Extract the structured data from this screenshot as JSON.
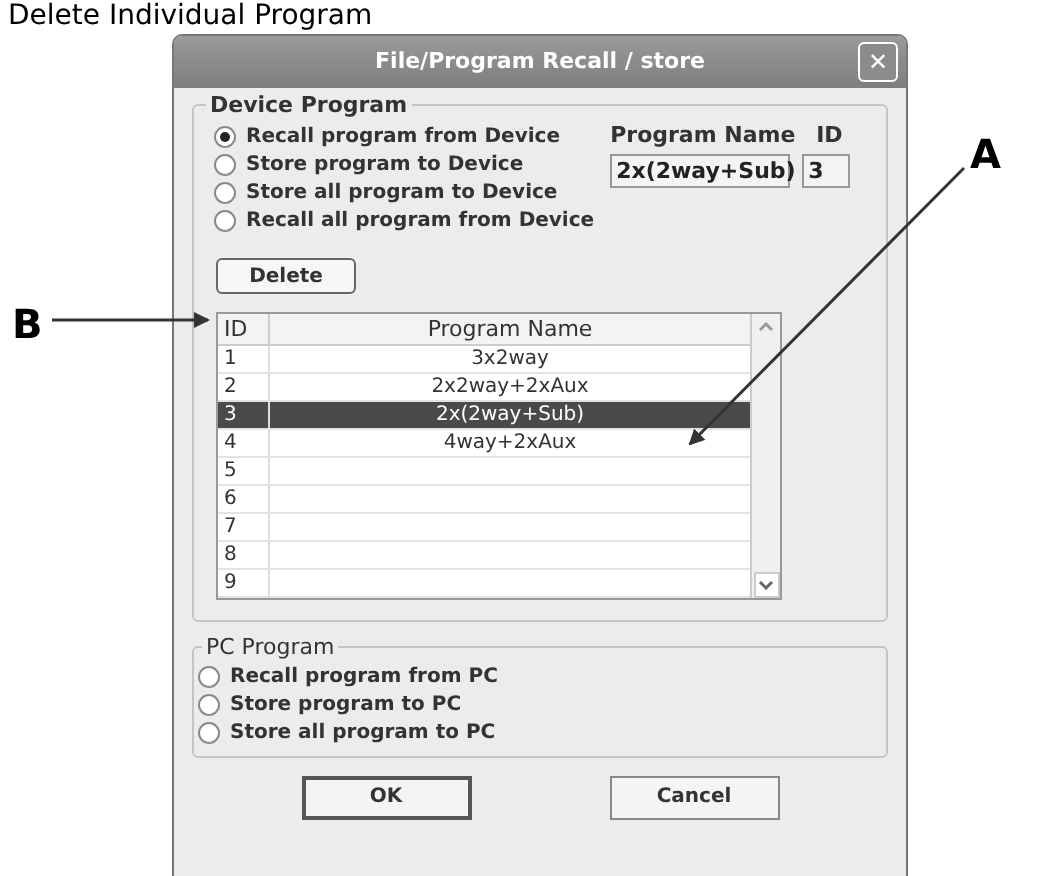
{
  "page_heading": "Delete Individual Program",
  "window": {
    "title": "File/Program Recall / store",
    "close": "✕"
  },
  "device_program": {
    "legend": "Device Program",
    "options": [
      {
        "label": "Recall program from Device",
        "selected": true
      },
      {
        "label": "Store program to Device",
        "selected": false
      },
      {
        "label": "Store all program to Device",
        "selected": false
      },
      {
        "label": "Recall all program from Device",
        "selected": false
      }
    ],
    "program_name_label": "Program Name",
    "id_label": "ID",
    "program_name_value": "2x(2way+Sub)",
    "id_value": "3",
    "delete_button": "Delete",
    "table": {
      "columns": [
        "ID",
        "Program Name"
      ],
      "rows": [
        {
          "id": "1",
          "name": "3x2way",
          "selected": false
        },
        {
          "id": "2",
          "name": "2x2way+2xAux",
          "selected": false
        },
        {
          "id": "3",
          "name": "2x(2way+Sub)",
          "selected": true
        },
        {
          "id": "4",
          "name": "4way+2xAux",
          "selected": false
        },
        {
          "id": "5",
          "name": "",
          "selected": false
        },
        {
          "id": "6",
          "name": "",
          "selected": false
        },
        {
          "id": "7",
          "name": "",
          "selected": false
        },
        {
          "id": "8",
          "name": "",
          "selected": false
        },
        {
          "id": "9",
          "name": "",
          "selected": false
        }
      ]
    }
  },
  "pc_program": {
    "legend": "PC Program",
    "options": [
      {
        "label": "Recall program from PC",
        "selected": false
      },
      {
        "label": "Store program to PC",
        "selected": false
      },
      {
        "label": "Store all program to PC",
        "selected": false
      }
    ]
  },
  "buttons": [
    "OK",
    "Cancel"
  ],
  "callouts": [
    "A",
    "B"
  ]
}
